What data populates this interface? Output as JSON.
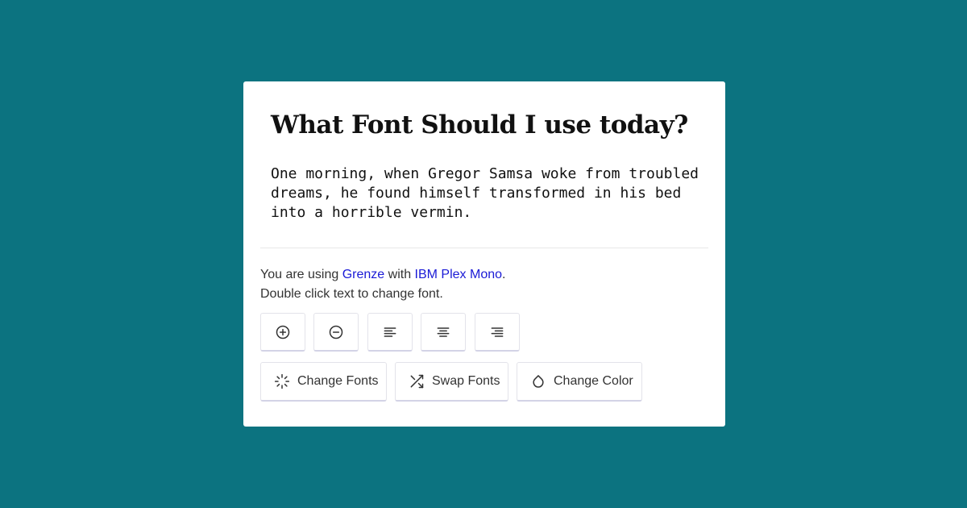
{
  "heading": "What Font Should I use today?",
  "sample_text": "One morning, when Gregor Samsa woke from troubled dreams, he found himself transformed in his bed into a horrible vermin.",
  "info": {
    "prefix": "You are using ",
    "heading_font": "Grenze",
    "middle": " with ",
    "body_font": "IBM Plex Mono",
    "suffix": ".",
    "hint": "Double click text to change font."
  },
  "toolbar": {
    "icon_buttons": [
      {
        "name": "increase-size",
        "icon": "plus-circle-icon"
      },
      {
        "name": "decrease-size",
        "icon": "minus-circle-icon"
      },
      {
        "name": "align-left",
        "icon": "align-left-icon"
      },
      {
        "name": "align-center",
        "icon": "align-center-icon"
      },
      {
        "name": "align-right",
        "icon": "align-right-icon"
      }
    ],
    "change_fonts_label": "Change Fonts",
    "change_fonts_icon": "loader-icon",
    "swap_fonts_label": "Swap Fonts",
    "swap_fonts_icon": "shuffle-icon",
    "change_color_label": "Change Color",
    "change_color_icon": "droplet-icon"
  },
  "colors": {
    "background": "#0c7380",
    "card": "#ffffff",
    "link": "#1a1ad6",
    "text": "#333333"
  }
}
